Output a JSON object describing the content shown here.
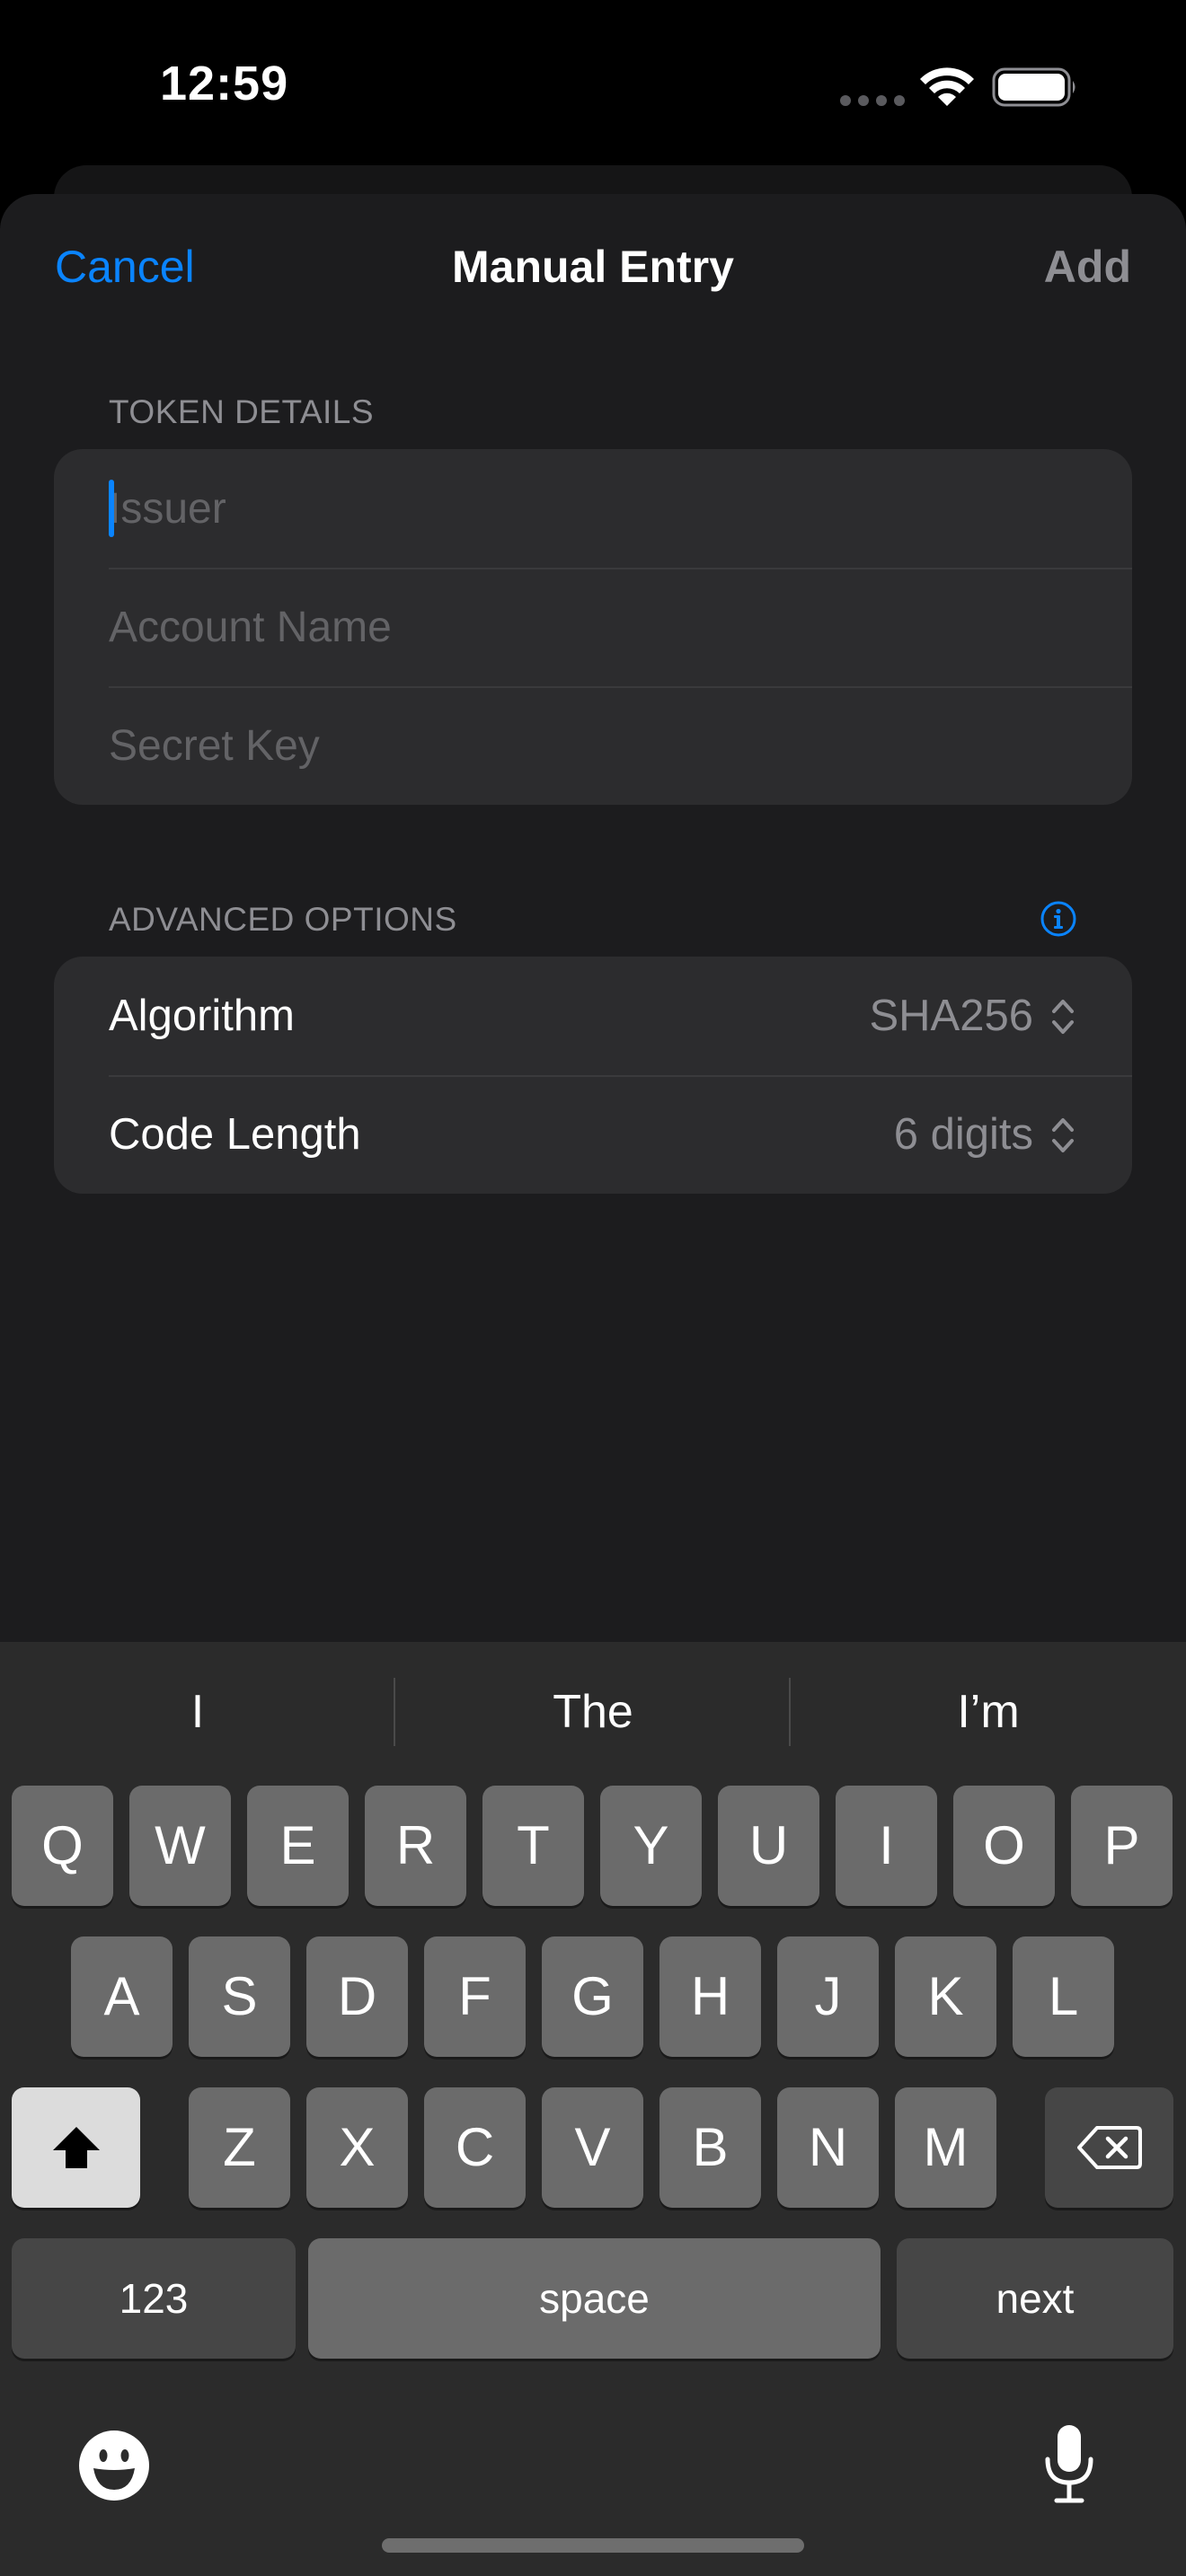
{
  "status_bar": {
    "time": "12:59"
  },
  "nav": {
    "cancel": "Cancel",
    "title": "Manual Entry",
    "add": "Add"
  },
  "token_details": {
    "header": "TOKEN DETAILS",
    "issuer_placeholder": "Issuer",
    "account_placeholder": "Account Name",
    "secret_placeholder": "Secret Key"
  },
  "advanced_options": {
    "header": "ADVANCED OPTIONS",
    "algorithm_label": "Algorithm",
    "algorithm_value": "SHA256",
    "code_length_label": "Code Length",
    "code_length_value": "6 digits"
  },
  "keyboard": {
    "suggestions": [
      "I",
      "The",
      "I’m"
    ],
    "row1": [
      "Q",
      "W",
      "E",
      "R",
      "T",
      "Y",
      "U",
      "I",
      "O",
      "P"
    ],
    "row2": [
      "A",
      "S",
      "D",
      "F",
      "G",
      "H",
      "J",
      "K",
      "L"
    ],
    "row3": [
      "Z",
      "X",
      "C",
      "V",
      "B",
      "N",
      "M"
    ],
    "numbers_key": "123",
    "space_key": "space",
    "return_key": "next"
  },
  "colors": {
    "accent": "#0a84ff",
    "sheet_bg": "#1c1c1e",
    "group_bg": "#2c2c2e",
    "keyboard_bg": "#2b2b2b"
  }
}
